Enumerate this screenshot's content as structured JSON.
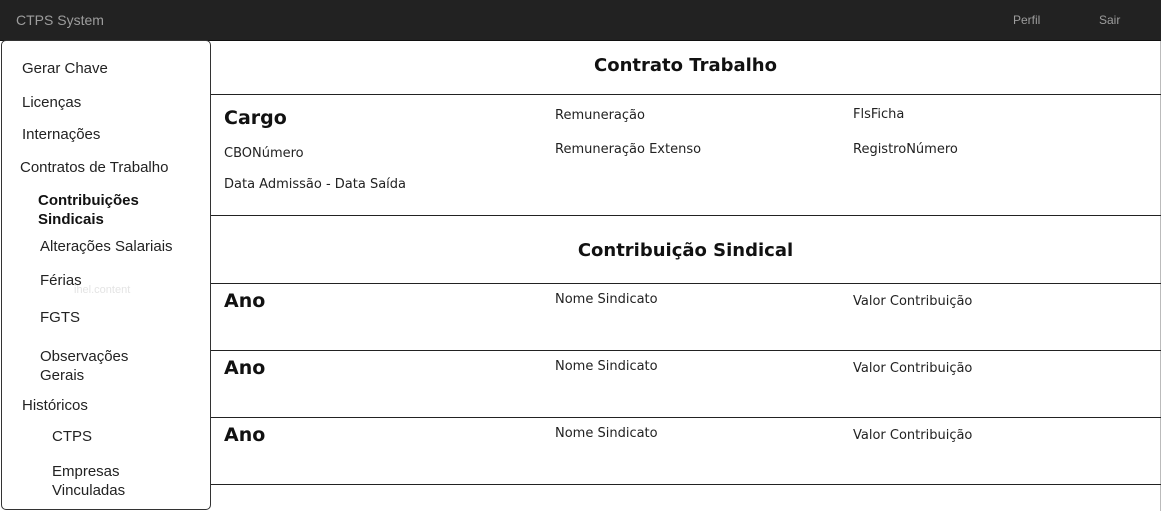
{
  "navbar": {
    "brand": "CTPS System",
    "links": [
      "Perfil",
      "Sair"
    ]
  },
  "sidebar": {
    "items": [
      {
        "label": "Gerar Chave"
      },
      {
        "label": "Licenças"
      },
      {
        "label": "Internações"
      },
      {
        "label": "Contratos de Trabalho"
      },
      {
        "label": "Contribuições Sindicais",
        "lines": [
          "Contribuições",
          "Sindicais"
        ],
        "active": true
      },
      {
        "label": "Alterações Salariais"
      },
      {
        "label": "Férias"
      },
      {
        "label": "FGTS"
      },
      {
        "label": "Observações Gerais",
        "lines": [
          "Observações",
          "Gerais"
        ]
      },
      {
        "label": "Históricos"
      },
      {
        "label": "CTPS"
      },
      {
        "label": "Empresas Vinculadas",
        "lines": [
          "Empresas",
          "Vinculadas"
        ]
      }
    ],
    "watermark": "ihel.content"
  },
  "contrato": {
    "title": "Contrato Trabalho",
    "cargo": "Cargo",
    "cbo": "CBONúmero",
    "datas": "Data Admissão - Data Saída",
    "remuneracao": "Remuneração",
    "remuneracao_extenso": "Remuneração Extenso",
    "fls_ficha": "FlsFicha",
    "registro": "RegistroNúmero"
  },
  "contribuicao": {
    "title": "Contribuição Sindical",
    "rows": [
      {
        "ano": "Ano",
        "sindicato": "Nome Sindicato",
        "valor": "Valor Contribuição"
      },
      {
        "ano": "Ano",
        "sindicato": "Nome Sindicato",
        "valor": "Valor Contribuição"
      },
      {
        "ano": "Ano",
        "sindicato": "Nome Sindicato",
        "valor": "Valor Contribuição"
      }
    ]
  }
}
